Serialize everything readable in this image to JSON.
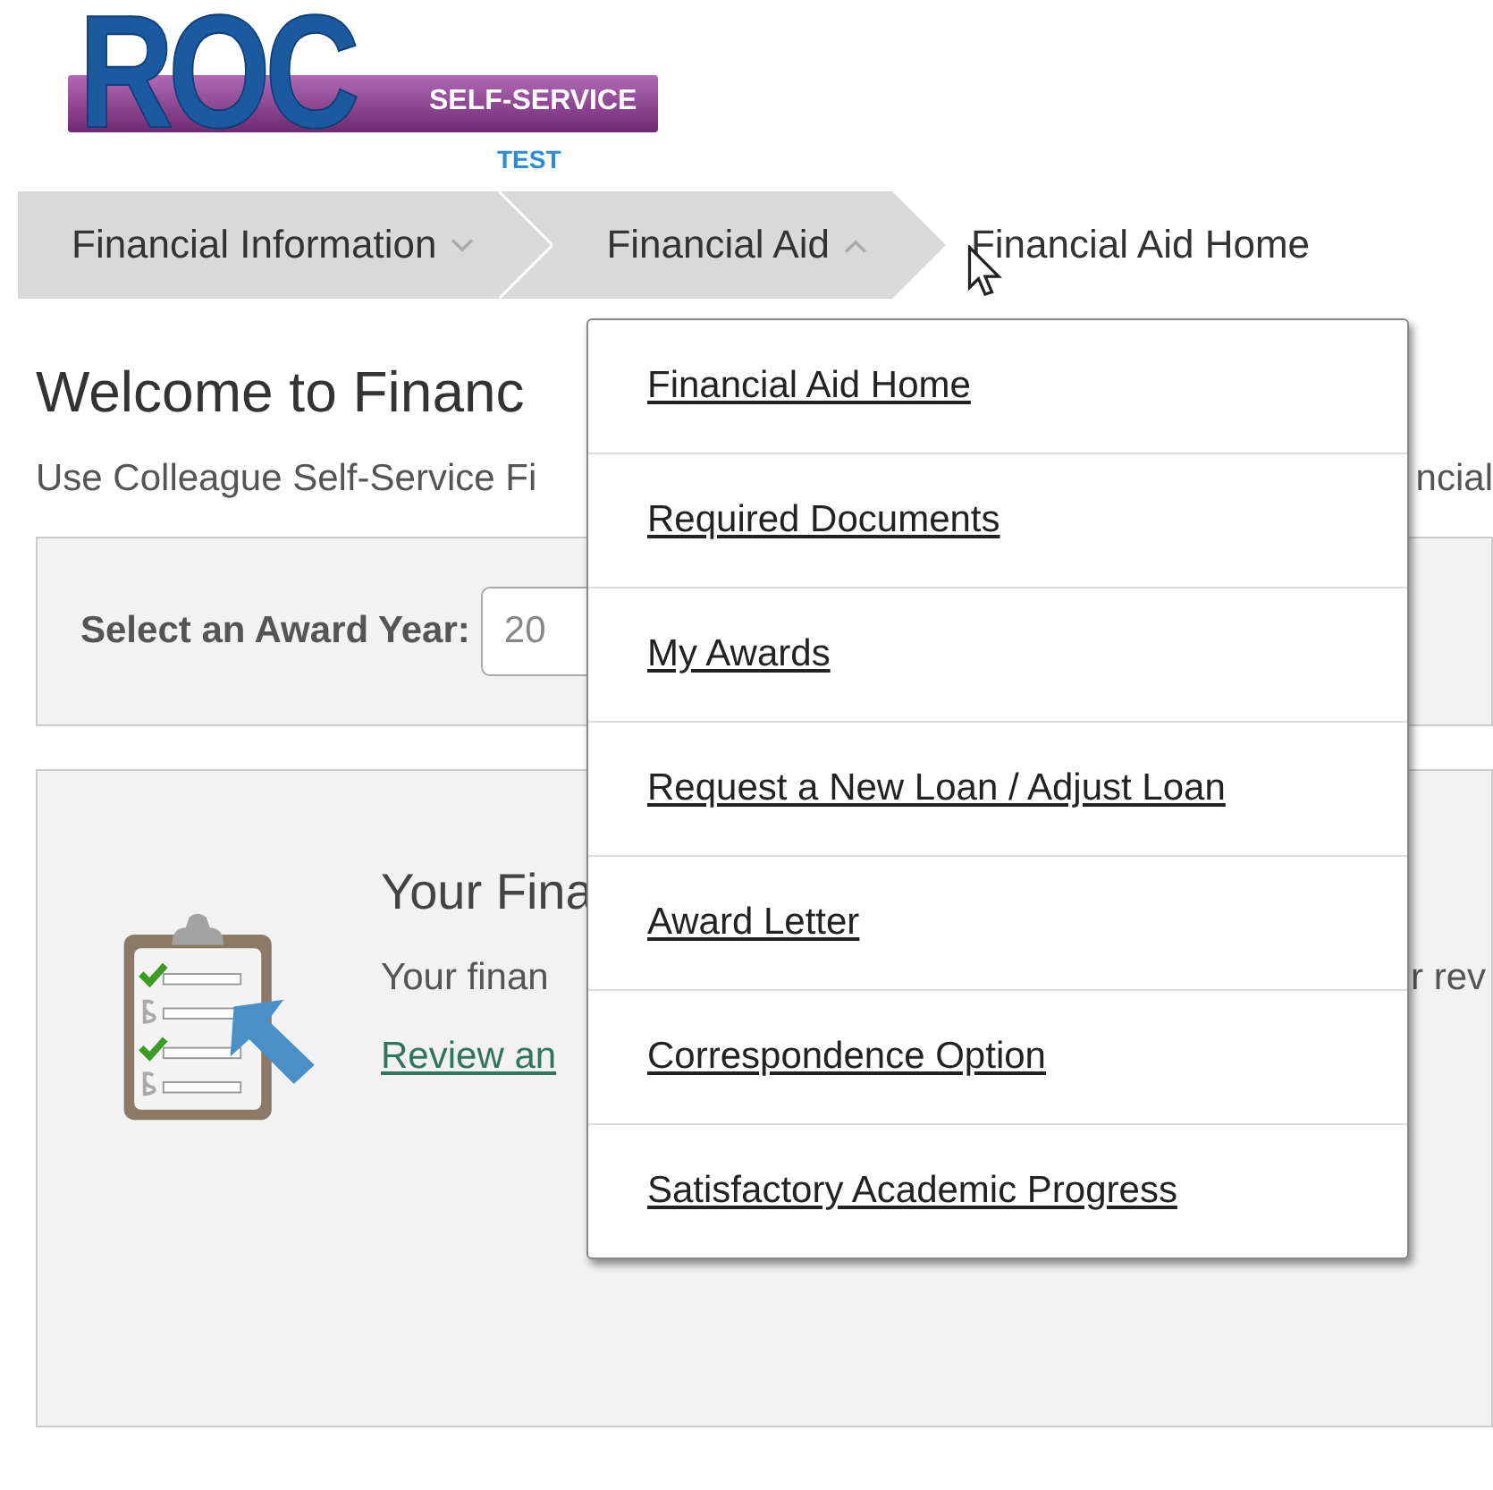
{
  "logo": {
    "wordmark": "ROC",
    "tagline": "SELF-SERVICE",
    "badge": "TEST"
  },
  "breadcrumbs": [
    {
      "label": "Financial Information",
      "kind": "menu",
      "expanded": false
    },
    {
      "label": "Financial Aid",
      "kind": "menu",
      "expanded": true
    },
    {
      "label": "Financial Aid Home",
      "kind": "current"
    }
  ],
  "dropdown": {
    "items": [
      "Financial Aid Home",
      "Required Documents",
      "My Awards",
      "Request a New Loan / Adjust Loan",
      "Award Letter",
      "Correspondence Option",
      "Satisfactory Academic Progress"
    ]
  },
  "page": {
    "title": "Welcome to Financ",
    "intro_left": "Use Colleague Self-Service Fi",
    "intro_right": "ncial",
    "award_year": {
      "label": "Select an Award Year:",
      "value": "20"
    },
    "card": {
      "title": "Your Fina",
      "text_left": "Your finan",
      "text_right": "r rev",
      "link": "Review an"
    }
  }
}
